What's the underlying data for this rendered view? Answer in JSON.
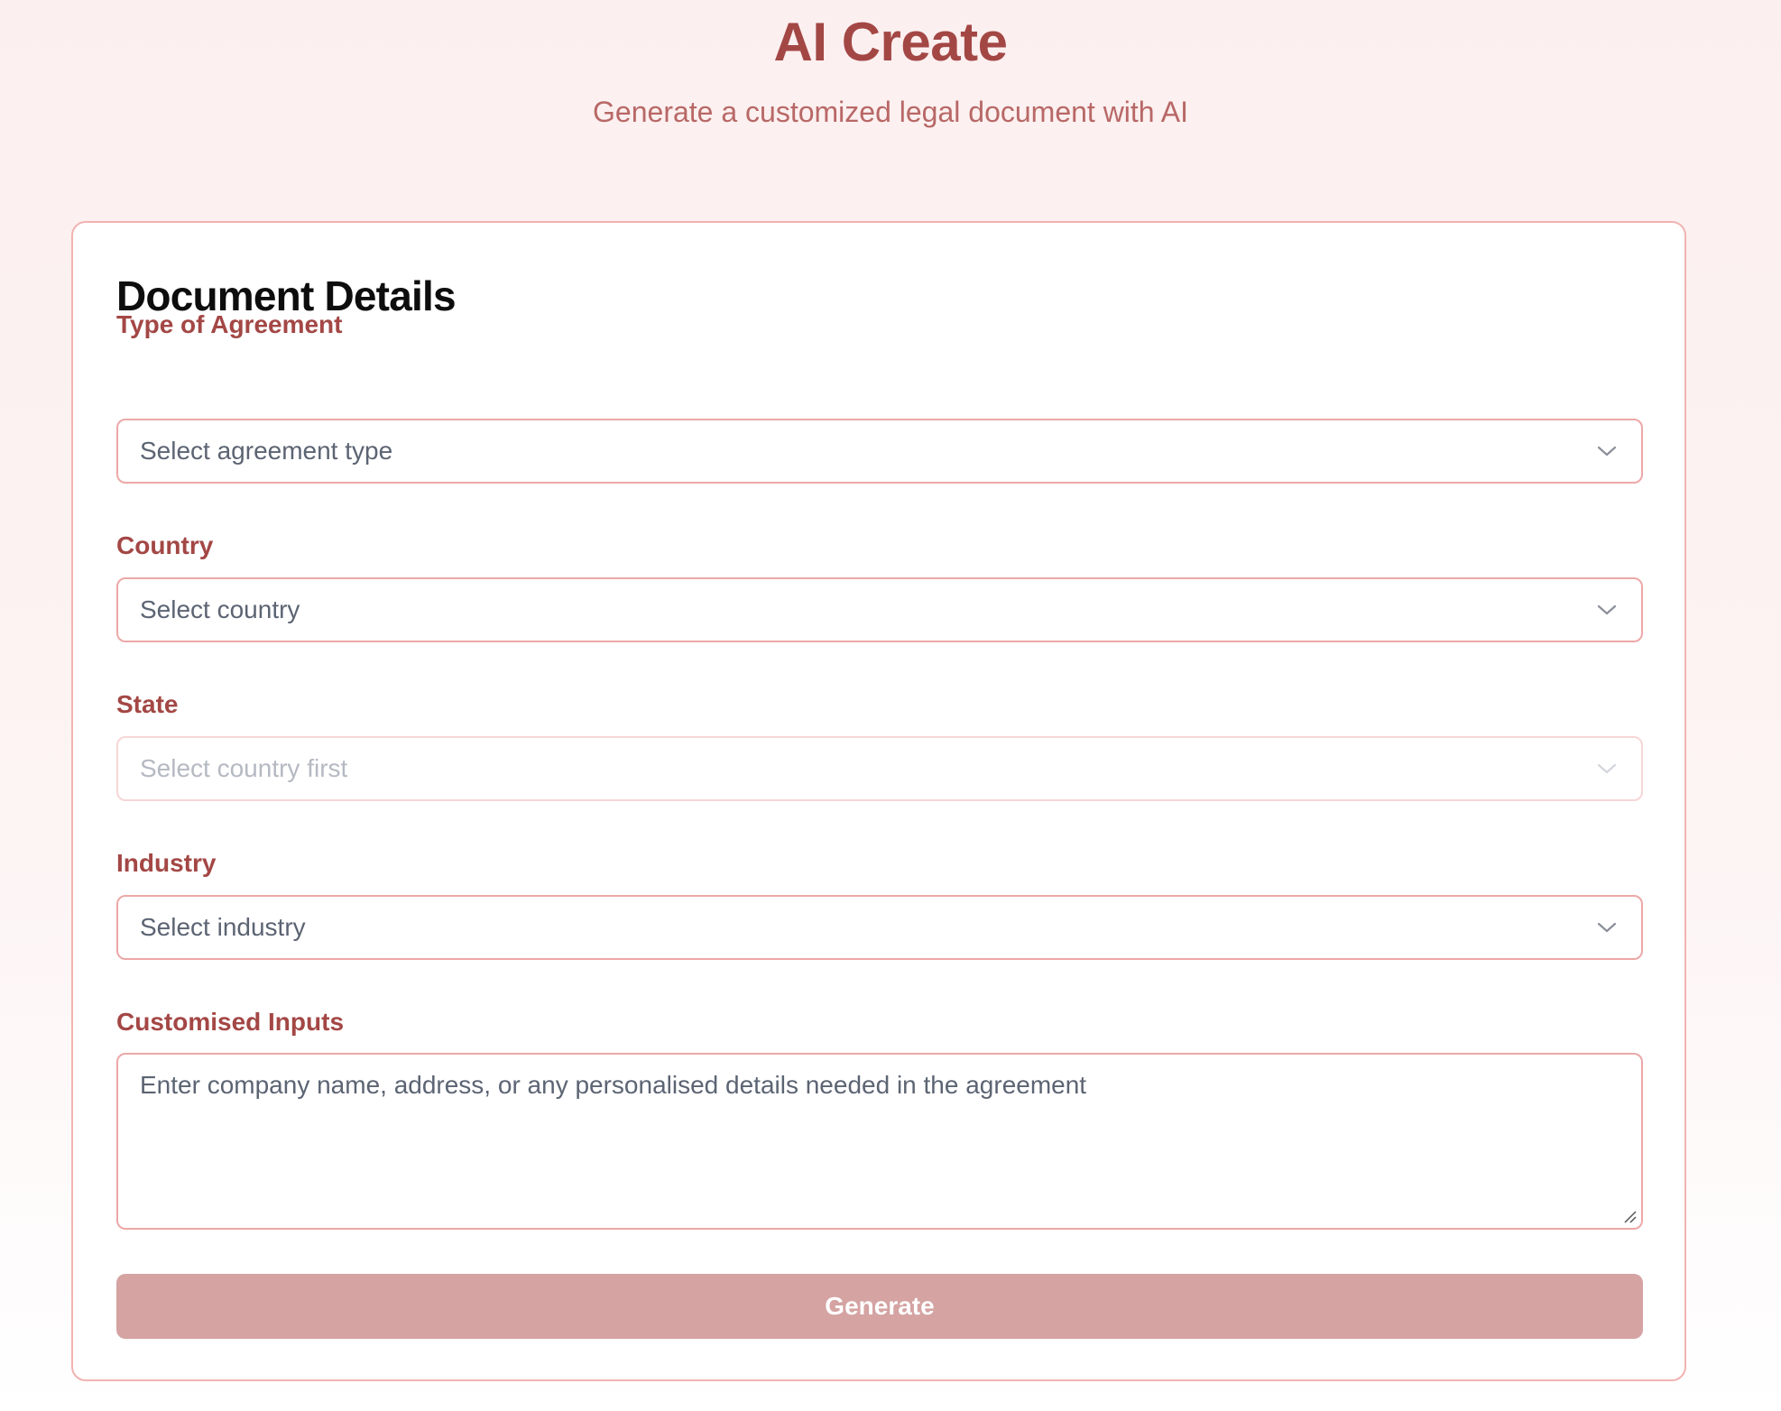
{
  "header": {
    "title": "AI Create",
    "subtitle": "Generate a customized legal document with AI"
  },
  "form": {
    "title": "Document Details",
    "fields": {
      "agreement_type": {
        "label": "Type of Agreement",
        "placeholder": "Select agreement type",
        "disabled": false
      },
      "country": {
        "label": "Country",
        "placeholder": "Select country",
        "disabled": false
      },
      "state": {
        "label": "State",
        "placeholder": "Select country first",
        "disabled": true
      },
      "industry": {
        "label": "Industry",
        "placeholder": "Select industry",
        "disabled": false
      },
      "custom_inputs": {
        "label": "Customised Inputs",
        "placeholder": "Enter company name, address, or any personalised details needed in the agreement"
      }
    },
    "submit_label": "Generate"
  },
  "colors": {
    "accent": "#a34745",
    "subtitle": "#b86866",
    "border": "#eda8a8",
    "button_disabled": "#d4a3a2"
  },
  "icons": {
    "select_arrow": "chevron-down-icon",
    "textarea_resize": "resize-grip-icon"
  }
}
